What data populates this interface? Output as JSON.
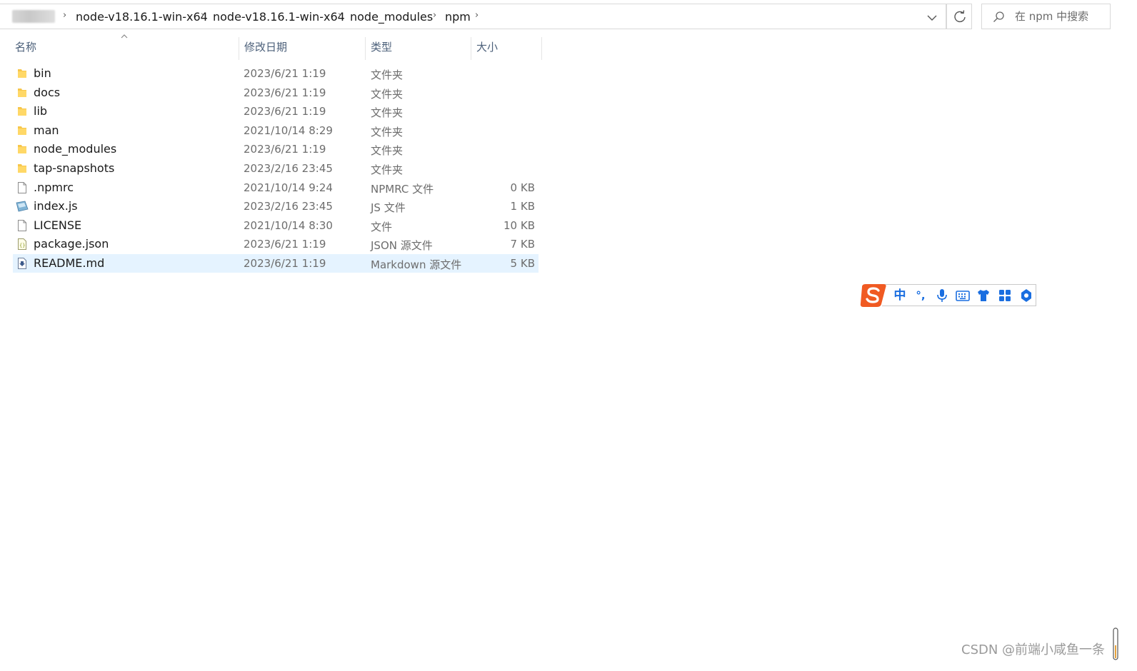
{
  "address_bar": {
    "breadcrumbs": [
      "node-v18.16.1-win-x64",
      "node-v18.16.1-win-x64",
      "node_modules",
      "npm"
    ]
  },
  "search": {
    "placeholder": "在 npm 中搜索"
  },
  "columns": {
    "name": "名称",
    "date": "修改日期",
    "type": "类型",
    "size": "大小"
  },
  "files": [
    {
      "name": "bin",
      "date": "2023/6/21 1:19",
      "type": "文件夹",
      "size": "",
      "icon": "folder-icon"
    },
    {
      "name": "docs",
      "date": "2023/6/21 1:19",
      "type": "文件夹",
      "size": "",
      "icon": "folder-icon"
    },
    {
      "name": "lib",
      "date": "2023/6/21 1:19",
      "type": "文件夹",
      "size": "",
      "icon": "folder-icon"
    },
    {
      "name": "man",
      "date": "2021/10/14 8:29",
      "type": "文件夹",
      "size": "",
      "icon": "folder-icon"
    },
    {
      "name": "node_modules",
      "date": "2023/6/21 1:19",
      "type": "文件夹",
      "size": "",
      "icon": "folder-icon"
    },
    {
      "name": "tap-snapshots",
      "date": "2023/2/16 23:45",
      "type": "文件夹",
      "size": "",
      "icon": "folder-icon"
    },
    {
      "name": ".npmrc",
      "date": "2021/10/14 9:24",
      "type": "NPMRC 文件",
      "size": "0 KB",
      "icon": "file-icon"
    },
    {
      "name": "index.js",
      "date": "2023/2/16 23:45",
      "type": "JS 文件",
      "size": "1 KB",
      "icon": "js-file-icon"
    },
    {
      "name": "LICENSE",
      "date": "2021/10/14 8:30",
      "type": "文件",
      "size": "10 KB",
      "icon": "file-icon"
    },
    {
      "name": "package.json",
      "date": "2023/6/21 1:19",
      "type": "JSON 源文件",
      "size": "7 KB",
      "icon": "json-file-icon"
    },
    {
      "name": "README.md",
      "date": "2023/6/21 1:19",
      "type": "Markdown 源文件",
      "size": "5 KB",
      "icon": "markdown-file-icon",
      "selected": true
    }
  ],
  "ime": {
    "mode": "中",
    "punct": "°,",
    "icons": [
      "sogou-logo-icon",
      "microphone-icon",
      "keyboard-icon",
      "skin-shirt-icon",
      "toolbox-grid-icon",
      "settings-icon"
    ]
  },
  "watermark": "CSDN @前端小咸鱼一条",
  "colors": {
    "selected_row": "#e5f3ff",
    "folder": "#f7c64a",
    "ime_accent": "#1a6ee0",
    "sogou_orange": "#f05a22"
  }
}
